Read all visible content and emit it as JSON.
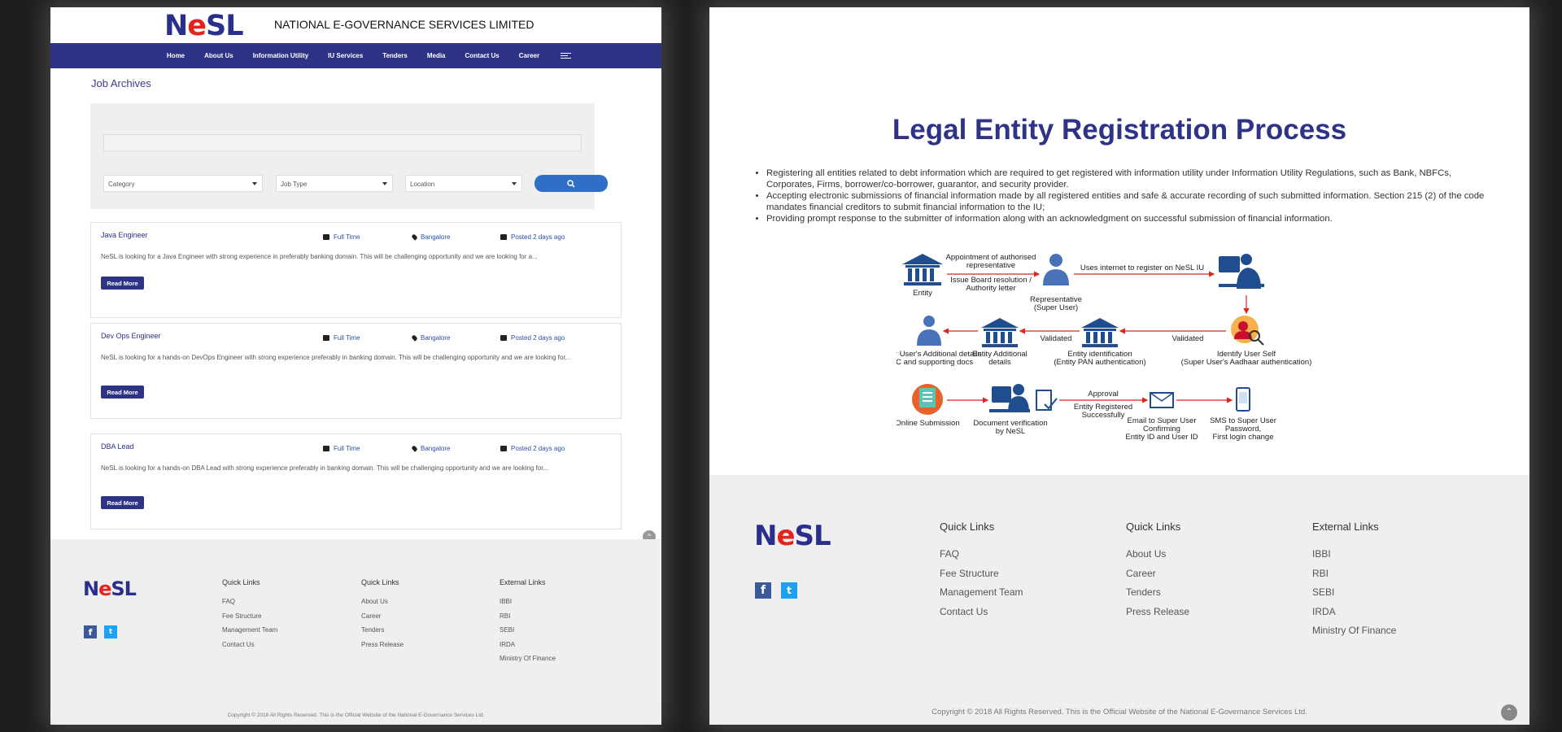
{
  "left": {
    "org_name": "NATIONAL E-GOVERNANCE SERVICES LIMITED",
    "nav": [
      "Home",
      "About Us",
      "Information Utility",
      "IU Services",
      "Tenders",
      "Media",
      "Contact Us",
      "Career"
    ],
    "page_title": "Job Archives",
    "filters": {
      "category": "Category",
      "job_type": "Job Type",
      "location": "Location"
    },
    "jobs": [
      {
        "title": "Java Engineer",
        "type": "Full Time",
        "location": "Bangalore",
        "posted": "Posted 2 days ago",
        "desc": "NeSL is looking for a Java Engineer with strong experience in preferably banking domain.  This will be challenging opportunity and we are looking for a...",
        "cta": "Read More"
      },
      {
        "title": "Dev Ops Engineer",
        "type": "Full Time",
        "location": "Bangalore",
        "posted": "Posted 2 days ago",
        "desc": "NeSL is looking for a hands-on DevOps Engineer with strong experience preferably in banking domain.  This will be challenging opportunity and we are looking for...",
        "cta": "Read More"
      },
      {
        "title": "DBA Lead",
        "type": "Full Time",
        "location": "Bangalore",
        "posted": "Posted 2 days ago",
        "desc": "NeSL is looking for a hands-on DBA Lead with strong experience preferably in banking domain.  This will be challenging opportunity and we are looking for...",
        "cta": "Read More"
      }
    ]
  },
  "logo": {
    "n": "N",
    "e": "e",
    "sl": "SL"
  },
  "footer": {
    "quick1": {
      "heading": "Quick Links",
      "items": [
        "FAQ",
        "Fee Structure",
        "Management Team",
        "Contact Us"
      ]
    },
    "quick2": {
      "heading": "Quick Links",
      "items": [
        "About Us",
        "Career",
        "Tenders",
        "Press Release"
      ]
    },
    "external": {
      "heading": "External Links",
      "items": [
        "IBBI",
        "RBI",
        "SEBI",
        "IRDA",
        "Ministry Of Finance"
      ]
    },
    "copyright": "Copyright © 2018 All Rights Reserved. This is the Official Website of the National E-Governance Services Ltd."
  },
  "right": {
    "title": "Legal Entity Registration Process",
    "bullets": [
      "Registering all entities related to debt information which are required to get registered with information utility under Information Utility Regulations, such as Bank, NBFCs, Corporates, Firms, borrower/co-borrower, guarantor, and security provider.",
      "Accepting electronic submissions of financial information made by all registered entities and safe & accurate recording of such submitted information. Section 215 (2) of the code mandates financial creditors to submit financial information to the IU;",
      "Providing prompt response to the submitter of information along with an acknowledgment on successful submission of financial information."
    ],
    "diagram": {
      "entity": "Entity",
      "appointment": [
        "Appointment of  authorised",
        "representative"
      ],
      "board": [
        "Issue Board resolution /",
        "Authority letter"
      ],
      "representative": [
        "Representative",
        "(Super User)"
      ],
      "uses_internet": "Uses internet to register on NeSL IU",
      "identify": [
        "Identify User Self",
        "(Super User's Aadhaar authentication)"
      ],
      "validated": "Validated",
      "entity_id": [
        "Entity identification",
        "(Entity PAN authentication)"
      ],
      "entity_additional": [
        "Entity Additional",
        "details"
      ],
      "super_user_details": [
        "Super User's Additional details",
        "DSC  and supporting docs"
      ],
      "online_submission": "Online Submission",
      "doc_verification": [
        "Document verification",
        "by NeSL"
      ],
      "approval": "Approval",
      "registered": [
        "Entity Registered",
        "Successfully"
      ],
      "email": [
        "Email to Super User",
        "Confirming",
        "Entity ID and User ID"
      ],
      "sms": [
        "SMS to Super User",
        "Password,",
        "First login change"
      ]
    }
  },
  "colors": {
    "brand": "#2f3386",
    "accent_red": "#e4231f",
    "footer_bg": "#efefef"
  },
  "icons": [
    "menu-icon",
    "search-icon",
    "briefcase-icon",
    "location-pin-icon",
    "calendar-icon",
    "facebook-icon",
    "twitter-icon",
    "scroll-top-icon"
  ]
}
